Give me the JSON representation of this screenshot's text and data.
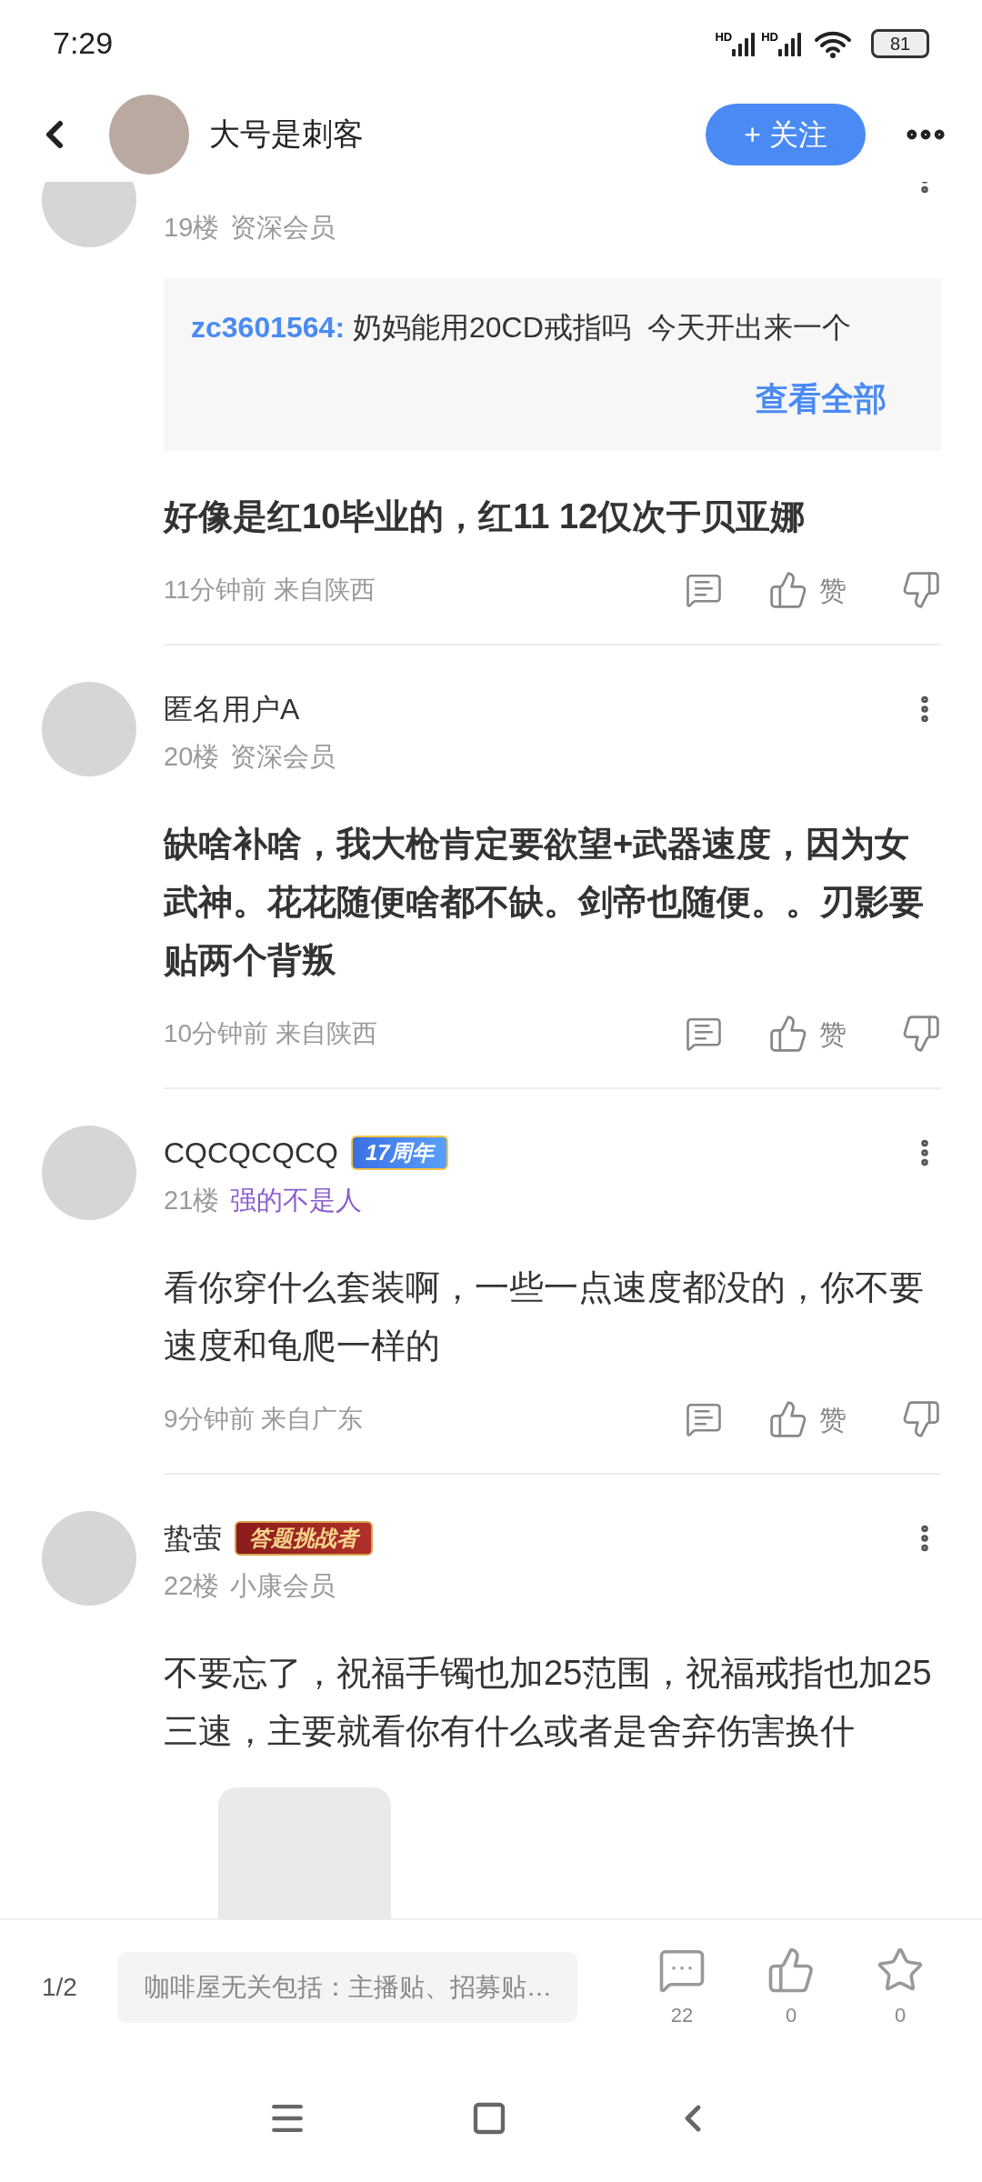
{
  "status_bar": {
    "time": "7:29",
    "signals": [
      {
        "label": "HD"
      },
      {
        "label": "HD"
      }
    ],
    "battery": "81"
  },
  "header": {
    "username": "大号是刺客",
    "follow_button": "+ 关注"
  },
  "comments": [
    {
      "floor": "19楼",
      "rank": {
        "text": "资深会员",
        "kind": "level"
      },
      "quote": {
        "user": "zc3601564:",
        "text": "奶妈能用20CD戒指吗  今天开出来一个",
        "more": "查看全部"
      },
      "body": "好像是红10毕业的，红11 12仅次于贝亚娜",
      "bold": true,
      "time": "11分钟前 来自陕西",
      "like_label": "赞"
    },
    {
      "name": "匿名用户A",
      "floor": "20楼",
      "rank": {
        "text": "资深会员",
        "kind": "level"
      },
      "body": "缺啥补啥，我大枪肯定要欲望+武器速度，因为女武神。花花随便啥都不缺。剑帝也随便。。刃影要贴两个背叛",
      "bold": true,
      "time": "10分钟前 来自陕西",
      "like_label": "赞"
    },
    {
      "name": "CQCQCQCQ",
      "badge": {
        "text": "17周年",
        "kind": "anniversary"
      },
      "floor": "21楼",
      "rank": {
        "text": "强的不是人",
        "kind": "title"
      },
      "body": "看你穿什么套装啊，一些一点速度都没的，你不要速度和龟爬一样的",
      "bold": false,
      "time": "9分钟前 来自广东",
      "like_label": "赞"
    },
    {
      "name": "蛰萤",
      "badge": {
        "text": "答题挑战者",
        "kind": "quiz"
      },
      "floor": "22楼",
      "rank": {
        "text": "小康会员",
        "kind": "level"
      },
      "body": "不要忘了，祝福手镯也加25范围，祝福戒指也加25三速，主要就看你有什么或者是舍弃伤害换什",
      "bold": false,
      "sticker": true
    }
  ],
  "bottom_bar": {
    "page": "1/2",
    "placeholder": "咖啡屋无关包括：主播贴、招募贴…",
    "comments_count": "22",
    "likes_count": "0",
    "stars_count": "0"
  }
}
